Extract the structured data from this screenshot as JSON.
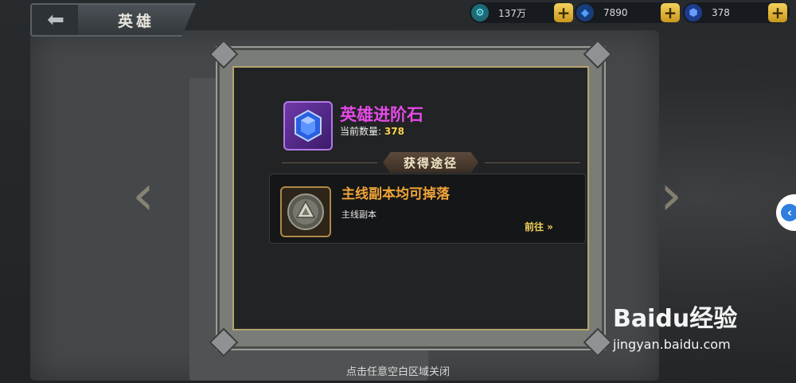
{
  "header": {
    "back_icon": "back-arrow-icon",
    "title": "英雄"
  },
  "resources": [
    {
      "icon": "gear-coin-icon",
      "value": "137万",
      "color": "#3fd0e0"
    },
    {
      "icon": "blue-crystal-icon",
      "value": "7890",
      "color": "#2c7df0"
    },
    {
      "icon": "sapphire-icon",
      "value": "378",
      "color": "#2a56d8"
    }
  ],
  "dialog": {
    "item_name": "英雄进阶石",
    "item_icon": "blue-gem-icon",
    "count_label": "当前数量:",
    "count_value": "378",
    "section_title": "获得途径",
    "source": {
      "icon": "triangle-emblem-icon",
      "title": "主线副本均可掉落",
      "subtitle": "主线副本",
      "go_label": "前往 »"
    }
  },
  "close_hint": "点击任意空白区域关闭",
  "watermark": {
    "main": "Baidu经验",
    "sub": "jingyan.baidu.com"
  }
}
